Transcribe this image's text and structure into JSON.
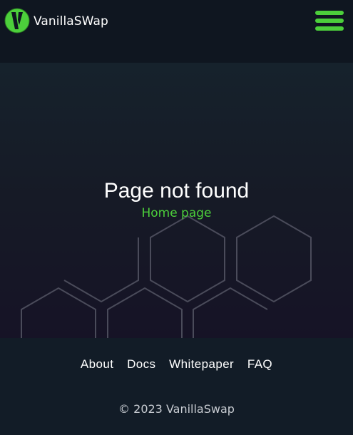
{
  "header": {
    "brand": "VanillaSWap",
    "logo_icon": "vanilla-v-logo-icon",
    "menu_icon": "hamburger-menu-icon"
  },
  "main": {
    "title": "Page not found",
    "home_link": "Home page"
  },
  "footer": {
    "nav": [
      "About",
      "Docs",
      "Whitepaper",
      "FAQ"
    ],
    "copyright": "© 2023 VanillaSwap"
  },
  "colors": {
    "accent": "#4ccf3b",
    "header_bg": "#0f1620",
    "footer_bg": "#121c27",
    "hex_stroke": "#4a4b5a"
  }
}
